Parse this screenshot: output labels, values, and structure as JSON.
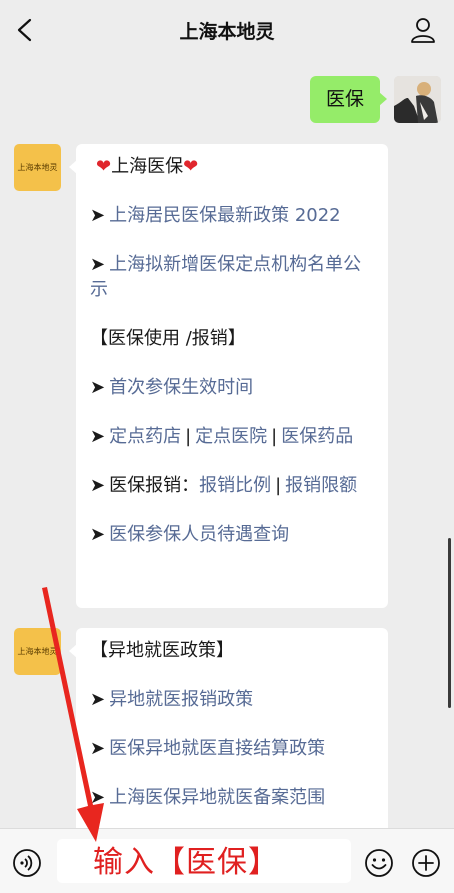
{
  "header": {
    "title": "上海本地灵",
    "back_icon": "chevron-left-icon",
    "profile_icon": "person-icon"
  },
  "chat": {
    "user_message": "医保",
    "bot_avatar_label": "上海本地灵",
    "bubble1": {
      "title": "上海医保",
      "items": [
        {
          "text": "上海居民医保最新政策 2022"
        },
        {
          "text": "上海拟新增医保定点机构名单公示"
        }
      ],
      "section": "【医保使用 /报销】",
      "items2": [
        {
          "text": "首次参保生效时间"
        }
      ],
      "row_links": [
        "定点药店",
        "定点医院",
        "医保药品"
      ],
      "reimburse_label": "医保报销：",
      "reimburse_links": [
        "报销比例",
        "报销限额"
      ],
      "last_item": "医保参保人员待遇查询"
    },
    "bubble2": {
      "section": "【异地就医政策】",
      "items": [
        "异地就医报销政策",
        "医保异地就医直接结算政策",
        "上海医保异地就医备案范围"
      ]
    }
  },
  "input": {
    "voice_icon": "voice-icon",
    "annotation": "输入【医保】",
    "emoji_icon": "emoji-icon",
    "plus_icon": "plus-icon"
  },
  "colors": {
    "link": "#576b95",
    "user_bubble": "#95ec69",
    "bot_avatar": "#f4c14a",
    "annotation": "#e02020"
  }
}
